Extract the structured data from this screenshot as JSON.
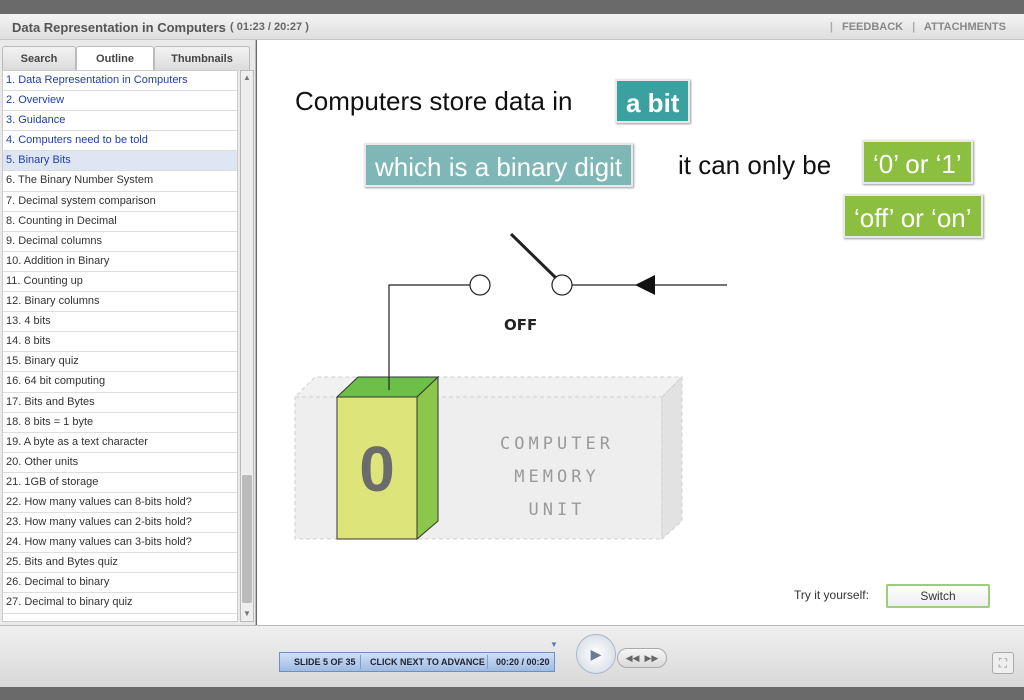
{
  "header": {
    "title": "Data Representation in Computers",
    "time": "( 01:23 / 20:27 )",
    "feedback": "FEEDBACK",
    "attachments": "ATTACHMENTS",
    "separator": "|"
  },
  "sidebar": {
    "tabs": [
      "Search",
      "Outline",
      "Thumbnails"
    ],
    "active_tab": "Outline",
    "items": [
      "1. Data Representation in Computers",
      "2. Overview",
      "3. Guidance",
      "4. Computers need to be told",
      "5. Binary Bits",
      "6. The Binary Number System",
      "7. Decimal system comparison",
      "8. Counting in Decimal",
      "9. Decimal columns",
      "10. Addition in Binary",
      "11. Counting up",
      "12. Binary columns",
      "13. 4 bits",
      "14. 8 bits",
      "15. Binary quiz",
      "16. 64 bit computing",
      "17. Bits and Bytes",
      "18. 8 bits = 1 byte",
      "19. A byte as a text character",
      "20. Other units",
      "21. 1GB of storage",
      "22. How many values can 8-bits hold?",
      "23. How many values can 2-bits hold?",
      "24. How many values can 3-bits hold?",
      "25. Bits and Bytes quiz",
      "26. Decimal to binary",
      "27. Decimal to binary quiz"
    ],
    "selected_index": 4
  },
  "slide": {
    "line1": "Computers store data in",
    "bit_label": "a bit",
    "binary_digit": "which is a binary digit",
    "line2": "it can only be",
    "values": "‘0’ or ‘1’",
    "states": "‘off’ or ‘on’",
    "switch_state": "OFF",
    "memory_lines": [
      "COMPUTER",
      "MEMORY",
      "UNIT"
    ],
    "digit": "0",
    "try_label": "Try it yourself:",
    "switch_button": "Switch"
  },
  "player": {
    "slide_count": "SLIDE 5 OF 35",
    "status": "CLICK NEXT TO ADVANCE",
    "time": "00:20 / 00:20"
  },
  "colors": {
    "teal": "#3aa0a0",
    "light_teal": "#7fb7b7",
    "green": "#8cbf3f",
    "memory_green": "#dde57a"
  }
}
